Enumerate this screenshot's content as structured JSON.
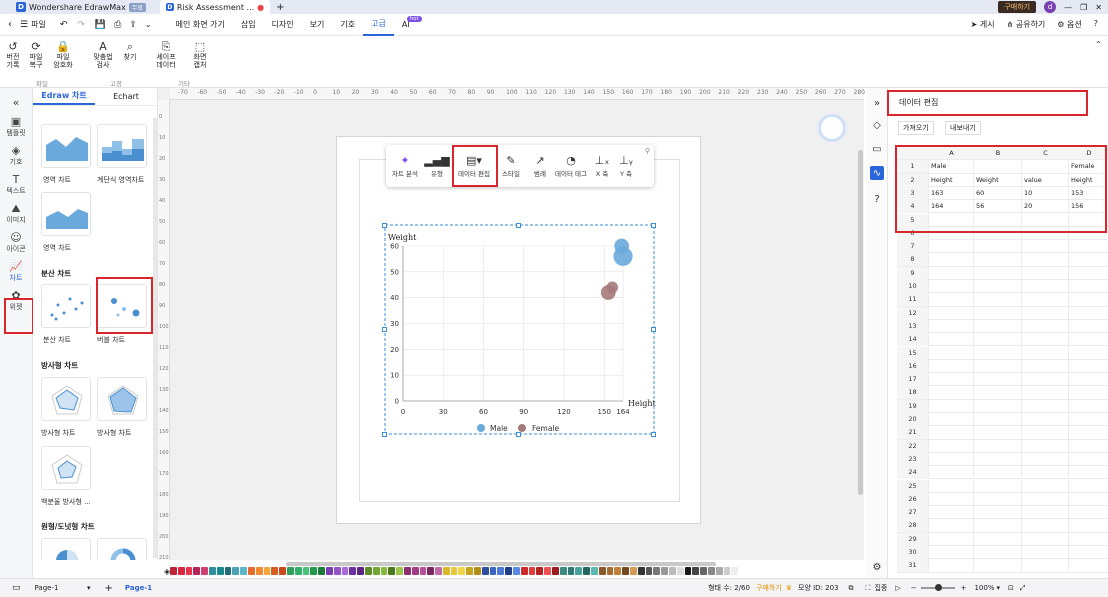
{
  "titlebar": {
    "app_name": "Wondershare EdrawMax",
    "app_badge": "무료",
    "doc_tab": "Risk Assessment ...",
    "buy_label": "구매하기",
    "avatar_letter": "d"
  },
  "menubar": {
    "file": "파일",
    "items": [
      "메인 화면 가기",
      "삽입",
      "디자인",
      "보기",
      "기호",
      "고급",
      "AI"
    ],
    "ai_badge": "hot",
    "right": [
      "게시",
      "공유하기",
      "옵션"
    ]
  },
  "ribbon": {
    "buttons": [
      {
        "icon": "↺",
        "label": "버전\n기록"
      },
      {
        "icon": "⟳",
        "label": "파일\n복구"
      },
      {
        "icon": "🔒",
        "label": "파일\n암호화"
      },
      {
        "icon": "A",
        "label": "맞춤법\n검사"
      },
      {
        "icon": "⌕",
        "label": "찾기"
      },
      {
        "icon": "⎘",
        "label": "셰이프\n데이터"
      },
      {
        "icon": "⬚",
        "label": "화면\n캡처"
      }
    ],
    "groups": [
      "파일",
      "고정",
      "기타"
    ]
  },
  "leftrail": [
    "템플릿",
    "기호",
    "텍스트",
    "이미지",
    "아이콘",
    "차트",
    "위젯"
  ],
  "library": {
    "tabs": [
      "Edraw 차트",
      "Echart"
    ],
    "area_items": [
      "영역 차트",
      "계단식 영역차트",
      "영역 차트"
    ],
    "scatter_title": "분산 차트",
    "scatter_items": [
      "분산 차트",
      "버블 차트"
    ],
    "radar_title": "방사형 차트",
    "radar_items": [
      "방사형 차트",
      "방사형 차트",
      "백분율 방사형 ..."
    ],
    "pie_title": "원형/도넛형 차트"
  },
  "ruler": {
    "h": [
      "-70",
      "-60",
      "-50",
      "-40",
      "-30",
      "-20",
      "-10",
      "0",
      "10",
      "20",
      "30",
      "40",
      "50",
      "60",
      "70",
      "80",
      "90",
      "100",
      "110",
      "120",
      "130",
      "140",
      "150",
      "160",
      "170",
      "180",
      "190",
      "200",
      "210",
      "220",
      "230",
      "240",
      "250",
      "260",
      "270",
      "280"
    ],
    "v": [
      "0",
      "10",
      "20",
      "30",
      "40",
      "50",
      "60",
      "70",
      "80",
      "90",
      "100",
      "110",
      "120",
      "130",
      "140",
      "150",
      "160",
      "170",
      "180",
      "190",
      "200",
      "210"
    ]
  },
  "chart_toolbar": [
    "차트 분석",
    "유형",
    "데이터 편집",
    "스타일",
    "범례",
    "데이터 태그",
    "X 축",
    "Y 축"
  ],
  "chart_data": {
    "type": "scatter",
    "ylabel": "Weight",
    "xlabel": "Height",
    "x_ticks": [
      "0",
      "30",
      "60",
      "90",
      "120",
      "150",
      "164"
    ],
    "y_ticks": [
      "0",
      "10",
      "20",
      "30",
      "40",
      "50",
      "60"
    ],
    "xlim": [
      0,
      164
    ],
    "ylim": [
      0,
      60
    ],
    "series": [
      {
        "name": "Male",
        "color": "#6aa9dc",
        "points": [
          {
            "x": 163,
            "y": 60,
            "size": 10
          },
          {
            "x": 164,
            "y": 56,
            "size": 20
          }
        ]
      },
      {
        "name": "Female",
        "color": "#a57a7a",
        "points": [
          {
            "x": 153,
            "y": 42,
            "size": 10
          },
          {
            "x": 156,
            "y": 44,
            "size": 5
          }
        ]
      }
    ]
  },
  "data_panel": {
    "title": "데이터 편집",
    "import": "가져오기",
    "export": "내보내기",
    "columns": [
      "A",
      "B",
      "C",
      "D"
    ],
    "rows": [
      [
        "Male",
        "",
        "",
        "Female"
      ],
      [
        "Height",
        "Weight",
        "value",
        "Height"
      ],
      [
        "163",
        "60",
        "10",
        "153"
      ],
      [
        "164",
        "56",
        "20",
        "156"
      ]
    ],
    "row_numbers": [
      "1",
      "2",
      "3",
      "4",
      "5",
      "6",
      "7",
      "8",
      "9",
      "10",
      "11",
      "12",
      "13",
      "14",
      "15",
      "16",
      "17",
      "18",
      "19",
      "20",
      "21",
      "22",
      "23",
      "24",
      "25",
      "26",
      "27",
      "28",
      "29",
      "30",
      "31"
    ]
  },
  "statusbar": {
    "page_select": "Page-1",
    "page_tab": "Page-1",
    "shapes": "형태 수: 2/60",
    "buy": "구매하기",
    "shape_id": "모양 ID: 203",
    "focus": "집중",
    "zoom": "100%"
  },
  "colors": {
    "accent": "#2a66d9",
    "highlight": "#d9262c",
    "swatches": [
      "#c0243a",
      "#d7263d",
      "#e8334a",
      "#b4275a",
      "#cf3f6f",
      "#2f8f9d",
      "#178a8c",
      "#1f6e7a",
      "#4aa3b5",
      "#5cb8c9",
      "#e86a2c",
      "#f28a30",
      "#f6a53a",
      "#d65d1f",
      "#c74a1c",
      "#2e9e5b",
      "#35b06a",
      "#46c47a",
      "#239a4a",
      "#1c7d3c",
      "#7a3fb4",
      "#9155c9",
      "#a86ad8",
      "#6b2fa0",
      "#5b2585",
      "#5e8c2a",
      "#73a533",
      "#87ba3f",
      "#4a7a20",
      "#9cc54b",
      "#8c2f6e",
      "#a33c84",
      "#b85199",
      "#7a2760",
      "#c06aa8",
      "#d9b82c",
      "#e6c93a",
      "#f0d64a",
      "#c7a21e",
      "#b38f16",
      "#2b4ea2",
      "#3a64c0",
      "#4a7ad6",
      "#1e3e88",
      "#5a8ae3",
      "#cc2b2b",
      "#e03c3c",
      "#b52222",
      "#f05050",
      "#9a1c1c",
      "#3c8c84",
      "#2f7a73",
      "#4aa39a",
      "#226660",
      "#5cb8ae",
      "#8a5a2a",
      "#a66d33",
      "#c0803c",
      "#704822",
      "#d69a55",
      "#333333",
      "#555555",
      "#777777",
      "#999999",
      "#bbbbbb",
      "#dddddd",
      "#1a1a1a",
      "#444444",
      "#666666",
      "#888888",
      "#aaaaaa",
      "#cccccc",
      "#eeeeee"
    ]
  }
}
